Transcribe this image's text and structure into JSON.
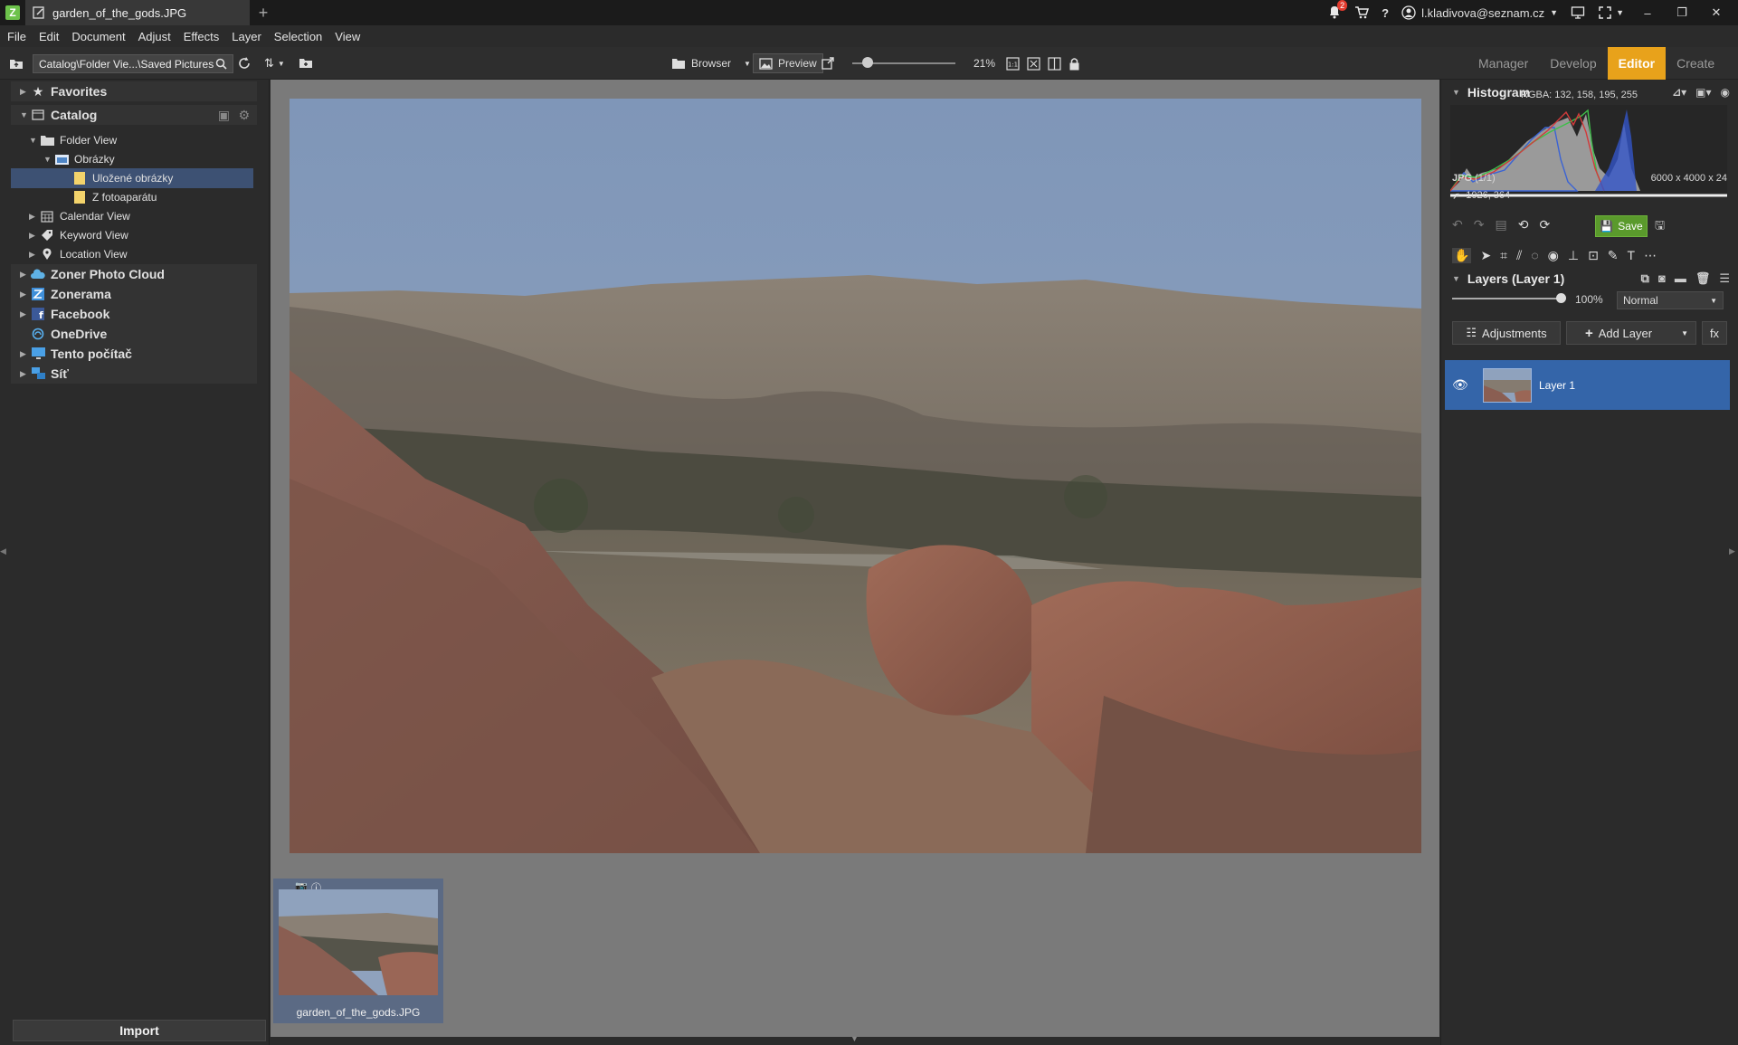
{
  "titlebar": {
    "doc_tab_title": "garden_of_the_gods.JPG",
    "tab_add": "+",
    "notification_count": "2",
    "user_email": "l.kladivova@seznam.cz"
  },
  "menu": [
    "File",
    "Edit",
    "Document",
    "Adjust",
    "Effects",
    "Layer",
    "Selection",
    "View"
  ],
  "toolbar": {
    "path": "Catalog\\Folder Vie...\\Saved Pictures",
    "browser_label": "Browser",
    "preview_label": "Preview",
    "zoom_percent": "21%",
    "zoom_slider_level": 0.15,
    "modes": [
      "Manager",
      "Develop",
      "Editor",
      "Create"
    ],
    "active_mode": "Editor"
  },
  "left_panel": {
    "favorites": "Favorites",
    "catalog": "Catalog",
    "folder_view": "Folder View",
    "obrazky": "Obrázky",
    "ulozene": "Uložené obrázky",
    "fotoaparat": "Z fotoaparátu",
    "calendar_view": "Calendar View",
    "keyword_view": "Keyword View",
    "location_view": "Location View",
    "zoner_cloud": "Zoner Photo Cloud",
    "zonerama": "Zonerama",
    "facebook": "Facebook",
    "onedrive": "OneDrive",
    "tento_pocitac": "Tento počítač",
    "sit": "Síť",
    "import": "Import"
  },
  "filmstrip": {
    "caption": "garden_of_the_gods.JPG"
  },
  "right_panel": {
    "histogram_title": "Histogram",
    "rgba": "RGBA: 132, 158, 195, 255",
    "file_format": "JPG",
    "file_count": "(1/1)",
    "dimensions": "6000 x 4000 x 24",
    "cursor_pos": "1026, 364",
    "save_label": "Save",
    "layers_title": "Layers (Layer 1)",
    "opacity": "100%",
    "opacity_level": 1.0,
    "blend_mode": "Normal",
    "adjustments_label": "Adjustments",
    "add_layer_label": "Add Layer",
    "fx_label": "fx",
    "layer_name": "Layer 1"
  },
  "colors": {
    "accent": "#e8a21b",
    "selection": "#3465a9",
    "save_green": "#5a9a2c"
  }
}
